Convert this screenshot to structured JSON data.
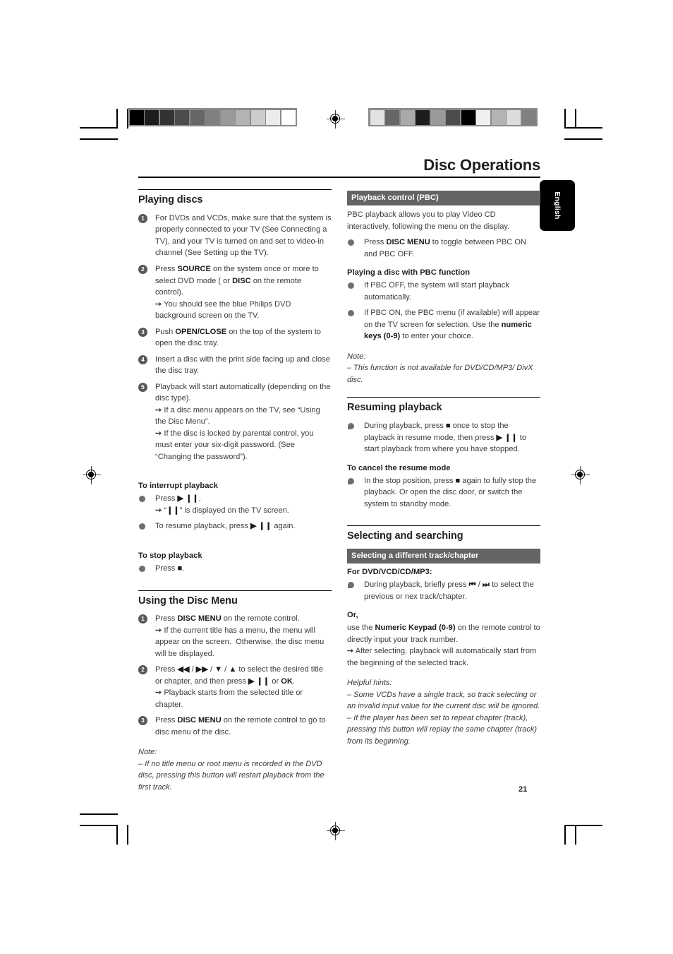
{
  "document": {
    "page_title": "Disc Operations",
    "page_number": "21",
    "language_tab": "English"
  },
  "left_column": {
    "section1": {
      "heading": "Playing discs",
      "steps": [
        {
          "num": "1",
          "html": "For DVDs and VCDs, make sure that the system is properly connected to your TV (See Connecting a TV), and your TV is turned on and set to video-in channel (See Setting up the TV)."
        },
        {
          "num": "2",
          "html": "Press <b>SOURCE</b> on the system once or more to select DVD mode ( or <b>DISC</b> on the remote control).<br><span class=\"arrow\">&#10137;</span> You should see the blue Philips DVD background screen on the TV."
        },
        {
          "num": "3",
          "html": "Push <b>OPEN/CLOSE</b> on the top of the system to open the disc tray."
        },
        {
          "num": "4",
          "html": "Insert a disc with the print side facing up and close the disc tray."
        },
        {
          "num": "5",
          "html": "Playback will start automatically (depending on the disc type).<br><span class=\"arrow\">&#10137;</span> If a disc menu appears on the TV, see &ldquo;Using the Disc Menu&rdquo;.<br><span class=\"arrow\">&#10137;</span> If the disc is locked by parental control, you must enter your six-digit password. (See &ldquo;Changing the password&rdquo;)."
        }
      ]
    },
    "interrupt": {
      "heading": "To interrupt playback",
      "bullets": [
        {
          "html": "Press <b>&#9654; &#10073;&#10073;</b>.<br><span class=\"arrow\">&#10137;</span> &ldquo;<b>&#10073;&#10073;</b>&rdquo; is displayed on the TV screen."
        },
        {
          "html": "To resume playback, press <b>&#9654; &#10073;&#10073;</b> again."
        }
      ]
    },
    "stop": {
      "heading": "To stop playback",
      "bullets": [
        {
          "html": "Press <b>&#9632;</b>."
        }
      ]
    },
    "section2": {
      "heading": "Using the Disc Menu",
      "steps": [
        {
          "num": "1",
          "html": "Press <b>DISC MENU</b> on the remote control.<br><span class=\"arrow\">&#10137;</span> If the current title has a menu, the menu will appear on the screen.&nbsp; Otherwise, the disc menu will be displayed."
        },
        {
          "num": "2",
          "html": "Press <b>&#9664;&#9664;</b> / <b>&#9654;&#9654;</b> / <b>&#9660;</b> / <b>&#9650;</b> to select the desired title or chapter, and then press <b>&#9654; &#10073;&#10073;</b> or <b>OK</b>.<br><span class=\"arrow\">&#10137;</span> Playback starts from the selected title or chapter."
        },
        {
          "num": "3",
          "html": "Press <b>DISC MENU</b> on the remote control to go to disc menu of the disc."
        }
      ],
      "note_label": "Note:",
      "note_text": "–  If no title menu or root menu is recorded in the DVD disc, pressing this button will restart playback from the first track."
    }
  },
  "right_column": {
    "pbc": {
      "bar_heading": "Playback  control (PBC)",
      "intro": "PBC playback allows you to play Video CD interactively, following the menu on the display.",
      "bullets": [
        {
          "html": "Press <b>DISC MENU</b> to toggle between PBC ON and PBC OFF."
        }
      ],
      "sub_heading": "Playing a disc with PBC function",
      "sub_bullets": [
        {
          "html": "If PBC OFF, the system will start playback automatically."
        },
        {
          "html": "If PBC ON, the PBC menu (if available) will appear on the TV screen for selection. Use the <b>numeric keys (0-9)</b> to enter your choice."
        }
      ],
      "note_label": "Note:",
      "note_text": "–  This function is not available for DVD/CD/MP3/ DivX disc."
    },
    "resuming": {
      "heading": "Resuming playback",
      "bullets": [
        {
          "html": "During playback, press <b>&#9632;</b> once to stop the playback in resume mode, then press <b>&#9654; &#10073;&#10073;</b> to start playback from where you have stopped."
        }
      ],
      "sub_heading": "To cancel the resume mode",
      "sub_bullets": [
        {
          "html": "In the stop position, press <b>&#9632;</b> again to fully stop the playback. Or open the disc door, or switch the system to standby mode."
        }
      ]
    },
    "selecting": {
      "heading": "Selecting and searching",
      "bar_heading": "Selecting a different track/chapter",
      "sub_heading": "For DVD/VCD/CD/MP3:",
      "bullets": [
        {
          "html": "During playback, briefly press <b>&#9198;</b> / <b>&#9197;</b> to select the previous or nex track/chapter."
        }
      ],
      "or_heading": "Or,",
      "or_text": "use the <b>Numeric Keypad (0-9)</b> on the remote control to directly input your track number.<br><span class=\"arrow\">&#10137;</span> After selecting, playback will automatically start from the beginning of the selected track.",
      "hints_label": "Helpful hints:",
      "hints": [
        "–  Some VCDs have a single track,  so track selecting or an invalid input value for the current disc will be ignored.",
        "–   If the player has been set to repeat chapter (track), pressing this button will replay the same chapter (track) from its beginning."
      ]
    }
  },
  "print_marks": {
    "gray_bar_left": [
      "#000000",
      "#1d1d1d",
      "#333333",
      "#4c4c4c",
      "#666666",
      "#808080",
      "#999999",
      "#b3b3b3",
      "#cccccc",
      "#ececec",
      "#ffffff"
    ],
    "gray_bar_right": [
      "#e2e2e2",
      "#666666",
      "#aaaaaa",
      "#1d1d1d",
      "#999999",
      "#4c4c4c",
      "#000000",
      "#f0f0f0",
      "#b3b3b3",
      "#dcdcdc",
      "#808080"
    ]
  }
}
